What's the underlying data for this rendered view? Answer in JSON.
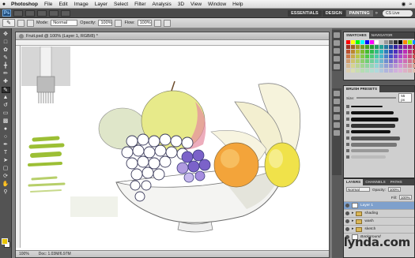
{
  "menu": {
    "apple": "",
    "app": "Photoshop",
    "items": [
      "File",
      "Edit",
      "Image",
      "Layer",
      "Select",
      "Filter",
      "Analysis",
      "3D",
      "View",
      "Window",
      "Help"
    ]
  },
  "appbar": {
    "logo": "Ps",
    "workspaces": [
      "ESSENTIALS",
      "DESIGN",
      "PAINTING"
    ],
    "active_workspace": "PAINTING",
    "cs_live": "CS Live"
  },
  "options": {
    "mode_label": "Mode:",
    "mode_value": "Normal",
    "opacity_label": "Opacity:",
    "opacity_value": "100%",
    "flow_label": "Flow:",
    "flow_value": "100%"
  },
  "document": {
    "tab_title": "Fruit.psd @ 100% (Layer 1, RGB/8) *",
    "zoom": "100%",
    "doc_size": "Doc: 1.03M/6.97M"
  },
  "panels": {
    "swatches_tabs": [
      "SWATCHES",
      "NAVIGATOR"
    ],
    "brush_presets_title": "BRUSH PRESETS",
    "size_label": "Size:",
    "size_value": "55 px",
    "layers_tabs": [
      "LAYERS",
      "CHANNELS",
      "PATHS"
    ],
    "blend_mode": "Normal",
    "opacity_label": "Opacity:",
    "opacity_value": "100%",
    "fill_label": "Fill:",
    "fill_value": "100%",
    "layers": [
      {
        "name": "Layer 1",
        "kind": "layer",
        "selected": true
      },
      {
        "name": "shading",
        "kind": "folder",
        "selected": false
      },
      {
        "name": "wash",
        "kind": "folder",
        "selected": false
      },
      {
        "name": "sketch",
        "kind": "folder",
        "selected": false
      },
      {
        "name": "Background",
        "kind": "layer",
        "selected": false
      }
    ]
  },
  "watermark": "lynda.com",
  "colors": {
    "foreground": "#e8c400",
    "background": "#ffffff",
    "layer_selected": "#7ea0cc"
  },
  "icons": [
    "brush-tool-icon",
    "move-icon",
    "marquee-icon",
    "lasso-icon",
    "quick-select-icon",
    "crop-icon",
    "eyedropper-icon",
    "healing-icon",
    "brush-icon",
    "stamp-icon",
    "history-brush-icon",
    "eraser-icon",
    "gradient-icon",
    "blur-icon",
    "dodge-icon",
    "pen-icon",
    "type-icon",
    "path-select-icon",
    "shape-icon",
    "hand-icon",
    "zoom-icon",
    "eye-icon",
    "folder-icon"
  ]
}
